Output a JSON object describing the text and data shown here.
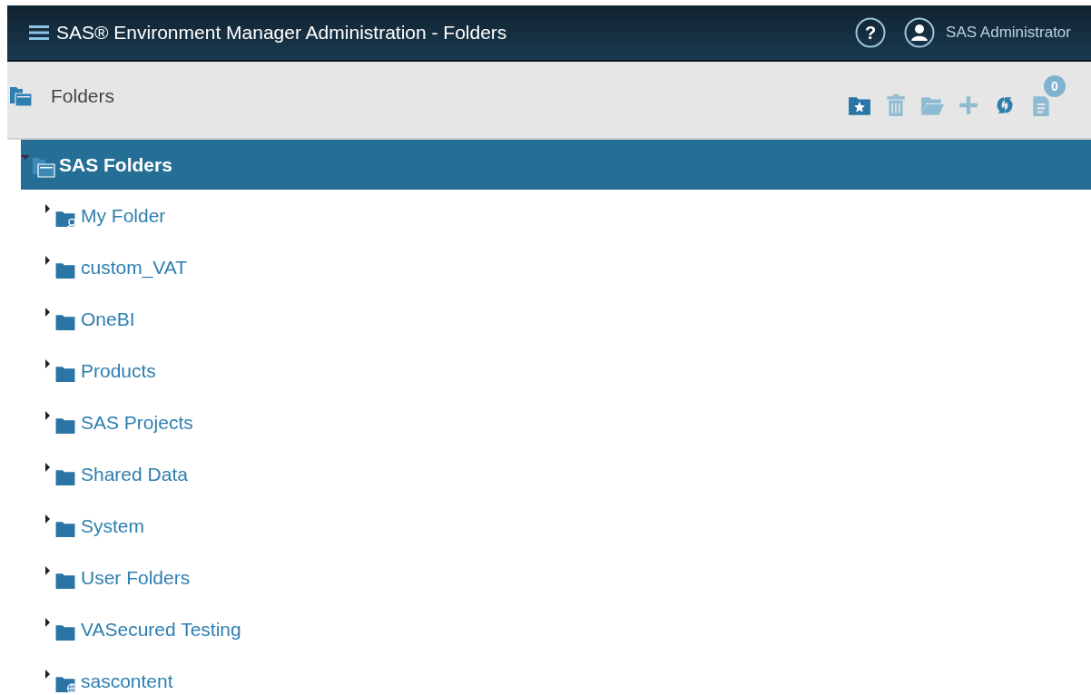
{
  "header": {
    "title": "SAS® Environment Manager Administration - Folders",
    "help": "?",
    "user": "SAS Administrator"
  },
  "toolbar": {
    "title": "Folders",
    "buttons": [
      {
        "kind": "new-folder",
        "disabled": false
      },
      {
        "kind": "delete",
        "disabled": true
      },
      {
        "kind": "move",
        "disabled": true
      },
      {
        "kind": "add",
        "disabled": true
      },
      {
        "kind": "refresh",
        "disabled": false
      },
      {
        "kind": "clipboard",
        "disabled": true,
        "badge": "0"
      }
    ]
  },
  "tree": {
    "label": "SAS Folders",
    "kind": "root",
    "expanded": true,
    "selected": true,
    "children": [
      {
        "label": "My Folder",
        "kind": "personal",
        "expanded": false,
        "selected": false
      },
      {
        "label": "custom_VAT",
        "kind": "folder",
        "expanded": false,
        "selected": false
      },
      {
        "label": "OneBI",
        "kind": "folder",
        "expanded": false,
        "selected": false
      },
      {
        "label": "Products",
        "kind": "folder",
        "expanded": false,
        "selected": false
      },
      {
        "label": "SAS Projects",
        "kind": "folder",
        "expanded": false,
        "selected": false
      },
      {
        "label": "Shared Data",
        "kind": "folder",
        "expanded": false,
        "selected": false
      },
      {
        "label": "System",
        "kind": "folder",
        "expanded": false,
        "selected": false
      },
      {
        "label": "User Folders",
        "kind": "folder",
        "expanded": false,
        "selected": false
      },
      {
        "label": "VASecured Testing",
        "kind": "folder",
        "expanded": false,
        "selected": false
      },
      {
        "label": "sascontent",
        "kind": "content",
        "expanded": false,
        "selected": false
      }
    ]
  }
}
